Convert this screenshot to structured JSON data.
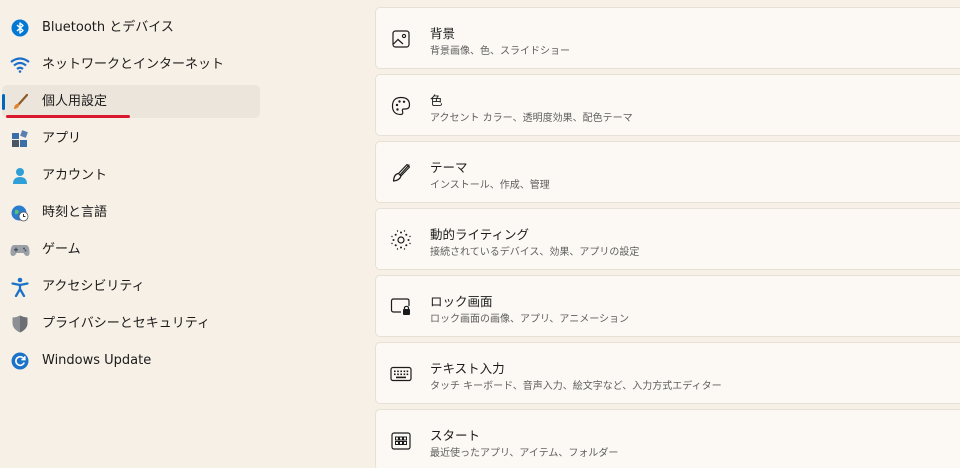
{
  "sidebar": {
    "items": [
      {
        "label": "Bluetooth とデバイス",
        "icon": "bluetooth-icon"
      },
      {
        "label": "ネットワークとインターネット",
        "icon": "wifi-icon"
      },
      {
        "label": "個人用設定",
        "icon": "brush-icon",
        "selected": true
      },
      {
        "label": "アプリ",
        "icon": "apps-icon"
      },
      {
        "label": "アカウント",
        "icon": "person-icon"
      },
      {
        "label": "時刻と言語",
        "icon": "globe-clock-icon"
      },
      {
        "label": "ゲーム",
        "icon": "gamepad-icon"
      },
      {
        "label": "アクセシビリティ",
        "icon": "accessibility-icon"
      },
      {
        "label": "プライバシーとセキュリティ",
        "icon": "shield-icon"
      },
      {
        "label": "Windows Update",
        "icon": "update-icon"
      }
    ]
  },
  "cards": [
    {
      "title": "背景",
      "desc": "背景画像、色、スライドショー",
      "icon": "image-icon"
    },
    {
      "title": "色",
      "desc": "アクセント カラー、透明度効果、配色テーマ",
      "icon": "palette-icon"
    },
    {
      "title": "テーマ",
      "desc": "インストール、作成、管理",
      "icon": "brush-icon"
    },
    {
      "title": "動的ライティング",
      "desc": "接続されているデバイス、効果、アプリの設定",
      "icon": "lighting-icon"
    },
    {
      "title": "ロック画面",
      "desc": "ロック画面の画像、アプリ、アニメーション",
      "icon": "lock-screen-icon"
    },
    {
      "title": "テキスト入力",
      "desc": "タッチ キーボード、音声入力、絵文字など、入力方式エディター",
      "icon": "keyboard-icon"
    },
    {
      "title": "スタート",
      "desc": "最近使ったアプリ、アイテム、フォルダー",
      "icon": "start-icon"
    }
  ],
  "colors": {
    "accent": "#0067c0",
    "highlight_underline": "#d9172e",
    "background": "#f7f0e6",
    "card": "#fcf9f4"
  }
}
